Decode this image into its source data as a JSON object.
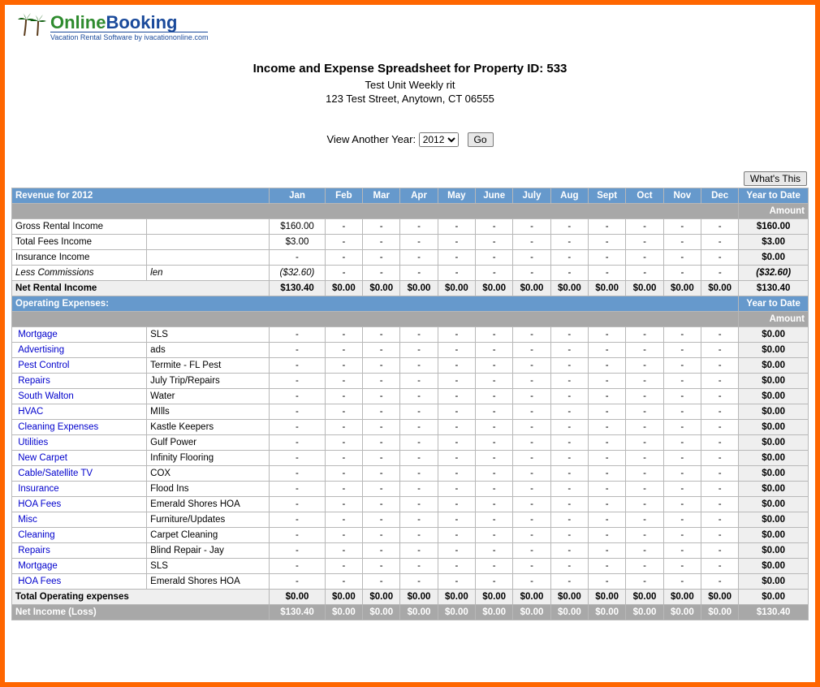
{
  "logo": {
    "green": "Online",
    "blue": "Booking",
    "sub": "Vacation Rental Software by ivacationonline.com"
  },
  "header": {
    "title": "Income and Expense Spreadsheet for Property ID: 533",
    "unit": "Test Unit Weekly rit",
    "address": "123 Test Street, Anytown, CT 06555"
  },
  "year_picker": {
    "label": "View Another Year:",
    "selected": "2012",
    "go": "Go"
  },
  "whats_this": "What's This",
  "months": [
    "Jan",
    "Feb",
    "Mar",
    "Apr",
    "May",
    "June",
    "July",
    "Aug",
    "Sept",
    "Oct",
    "Nov",
    "Dec"
  ],
  "revenue": {
    "heading": "Revenue for 2012",
    "ytd_heading": "Year to Date",
    "amount_heading": "Amount",
    "rows": [
      {
        "name": "Gross Rental Income",
        "desc": "",
        "link": false,
        "vals": [
          "$160.00",
          "-",
          "-",
          "-",
          "-",
          "-",
          "-",
          "-",
          "-",
          "-",
          "-",
          "-"
        ],
        "ytd": "$160.00"
      },
      {
        "name": "Total Fees Income",
        "desc": "",
        "link": false,
        "vals": [
          "$3.00",
          "-",
          "-",
          "-",
          "-",
          "-",
          "-",
          "-",
          "-",
          "-",
          "-",
          "-"
        ],
        "ytd": "$3.00"
      },
      {
        "name": "Insurance Income",
        "desc": "",
        "link": false,
        "vals": [
          "-",
          "-",
          "-",
          "-",
          "-",
          "-",
          "-",
          "-",
          "-",
          "-",
          "-",
          "-"
        ],
        "ytd": "$0.00"
      },
      {
        "name": " Less Commissions",
        "desc": "len",
        "link": false,
        "italic": true,
        "vals": [
          "($32.60)",
          "-",
          "-",
          "-",
          "-",
          "-",
          "-",
          "-",
          "-",
          "-",
          "-",
          "-"
        ],
        "ytd": "($32.60)"
      }
    ],
    "total": {
      "name": "Net Rental Income",
      "vals": [
        "$130.40",
        "$0.00",
        "$0.00",
        "$0.00",
        "$0.00",
        "$0.00",
        "$0.00",
        "$0.00",
        "$0.00",
        "$0.00",
        "$0.00",
        "$0.00"
      ],
      "ytd": "$130.40"
    }
  },
  "expenses": {
    "heading": "Operating Expenses:",
    "ytd_heading": "Year to Date",
    "amount_heading": "Amount",
    "rows": [
      {
        "name": "Mortgage",
        "desc": "SLS",
        "link": true,
        "vals": [
          "-",
          "-",
          "-",
          "-",
          "-",
          "-",
          "-",
          "-",
          "-",
          "-",
          "-",
          "-"
        ],
        "ytd": "$0.00"
      },
      {
        "name": "Advertising",
        "desc": "ads",
        "link": true,
        "vals": [
          "-",
          "-",
          "-",
          "-",
          "-",
          "-",
          "-",
          "-",
          "-",
          "-",
          "-",
          "-"
        ],
        "ytd": "$0.00"
      },
      {
        "name": "Pest Control",
        "desc": "Termite - FL Pest",
        "link": true,
        "vals": [
          "-",
          "-",
          "-",
          "-",
          "-",
          "-",
          "-",
          "-",
          "-",
          "-",
          "-",
          "-"
        ],
        "ytd": "$0.00"
      },
      {
        "name": "Repairs",
        "desc": "July Trip/Repairs",
        "link": true,
        "vals": [
          "-",
          "-",
          "-",
          "-",
          "-",
          "-",
          "-",
          "-",
          "-",
          "-",
          "-",
          "-"
        ],
        "ytd": "$0.00"
      },
      {
        "name": "South Walton",
        "desc": "Water",
        "link": true,
        "vals": [
          "-",
          "-",
          "-",
          "-",
          "-",
          "-",
          "-",
          "-",
          "-",
          "-",
          "-",
          "-"
        ],
        "ytd": "$0.00"
      },
      {
        "name": "HVAC",
        "desc": "MIlls",
        "link": true,
        "vals": [
          "-",
          "-",
          "-",
          "-",
          "-",
          "-",
          "-",
          "-",
          "-",
          "-",
          "-",
          "-"
        ],
        "ytd": "$0.00"
      },
      {
        "name": "Cleaning Expenses",
        "desc": "Kastle Keepers",
        "link": true,
        "vals": [
          "-",
          "-",
          "-",
          "-",
          "-",
          "-",
          "-",
          "-",
          "-",
          "-",
          "-",
          "-"
        ],
        "ytd": "$0.00"
      },
      {
        "name": "Utilities",
        "desc": "Gulf Power",
        "link": true,
        "vals": [
          "-",
          "-",
          "-",
          "-",
          "-",
          "-",
          "-",
          "-",
          "-",
          "-",
          "-",
          "-"
        ],
        "ytd": "$0.00"
      },
      {
        "name": "New Carpet",
        "desc": "Infinity Flooring",
        "link": true,
        "vals": [
          "-",
          "-",
          "-",
          "-",
          "-",
          "-",
          "-",
          "-",
          "-",
          "-",
          "-",
          "-"
        ],
        "ytd": "$0.00"
      },
      {
        "name": "Cable/Satellite TV",
        "desc": "COX",
        "link": true,
        "vals": [
          "-",
          "-",
          "-",
          "-",
          "-",
          "-",
          "-",
          "-",
          "-",
          "-",
          "-",
          "-"
        ],
        "ytd": "$0.00"
      },
      {
        "name": "Insurance",
        "desc": "Flood Ins",
        "link": true,
        "vals": [
          "-",
          "-",
          "-",
          "-",
          "-",
          "-",
          "-",
          "-",
          "-",
          "-",
          "-",
          "-"
        ],
        "ytd": "$0.00"
      },
      {
        "name": "HOA Fees",
        "desc": "Emerald Shores HOA",
        "link": true,
        "vals": [
          "-",
          "-",
          "-",
          "-",
          "-",
          "-",
          "-",
          "-",
          "-",
          "-",
          "-",
          "-"
        ],
        "ytd": "$0.00"
      },
      {
        "name": "Misc",
        "desc": "Furniture/Updates",
        "link": true,
        "vals": [
          "-",
          "-",
          "-",
          "-",
          "-",
          "-",
          "-",
          "-",
          "-",
          "-",
          "-",
          "-"
        ],
        "ytd": "$0.00"
      },
      {
        "name": "Cleaning",
        "desc": "Carpet Cleaning",
        "link": true,
        "vals": [
          "-",
          "-",
          "-",
          "-",
          "-",
          "-",
          "-",
          "-",
          "-",
          "-",
          "-",
          "-"
        ],
        "ytd": "$0.00"
      },
      {
        "name": "Repairs",
        "desc": "Blind Repair - Jay",
        "link": true,
        "vals": [
          "-",
          "-",
          "-",
          "-",
          "-",
          "-",
          "-",
          "-",
          "-",
          "-",
          "-",
          "-"
        ],
        "ytd": "$0.00"
      },
      {
        "name": "Mortgage",
        "desc": "SLS",
        "link": true,
        "vals": [
          "-",
          "-",
          "-",
          "-",
          "-",
          "-",
          "-",
          "-",
          "-",
          "-",
          "-",
          "-"
        ],
        "ytd": "$0.00"
      },
      {
        "name": "HOA Fees",
        "desc": "Emerald Shores HOA",
        "link": true,
        "vals": [
          "-",
          "-",
          "-",
          "-",
          "-",
          "-",
          "-",
          "-",
          "-",
          "-",
          "-",
          "-"
        ],
        "ytd": "$0.00"
      }
    ],
    "total": {
      "name": "Total Operating expenses",
      "vals": [
        "$0.00",
        "$0.00",
        "$0.00",
        "$0.00",
        "$0.00",
        "$0.00",
        "$0.00",
        "$0.00",
        "$0.00",
        "$0.00",
        "$0.00",
        "$0.00"
      ],
      "ytd": "$0.00"
    }
  },
  "net": {
    "name": "Net Income (Loss)",
    "vals": [
      "$130.40",
      "$0.00",
      "$0.00",
      "$0.00",
      "$0.00",
      "$0.00",
      "$0.00",
      "$0.00",
      "$0.00",
      "$0.00",
      "$0.00",
      "$0.00"
    ],
    "ytd": "$130.40"
  }
}
